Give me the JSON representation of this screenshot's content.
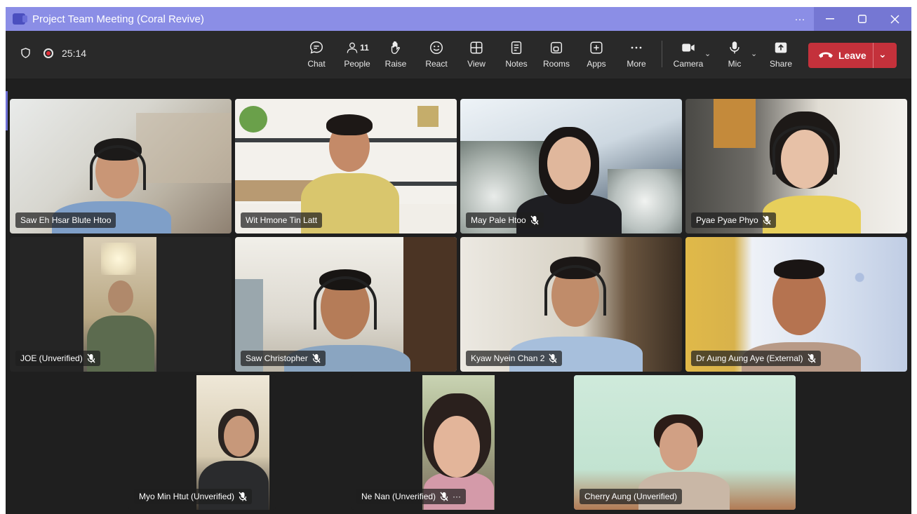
{
  "window": {
    "title": "Project Team Meeting (Coral Revive)",
    "more": "···"
  },
  "meeting": {
    "timer": "25:14"
  },
  "toolbar": {
    "chat": "Chat",
    "people": "People",
    "people_count": "11",
    "raise": "Raise",
    "react": "React",
    "view": "View",
    "notes": "Notes",
    "rooms": "Rooms",
    "apps": "Apps",
    "more": "More",
    "camera": "Camera",
    "mic": "Mic",
    "share": "Share",
    "leave": "Leave"
  },
  "participants": [
    {
      "name": "Saw Eh Hsar Blute Htoo",
      "muted": false
    },
    {
      "name": "Wit Hmone Tin Latt",
      "muted": false
    },
    {
      "name": "May Pale Htoo",
      "muted": true
    },
    {
      "name": "Pyae Pyae Phyo",
      "muted": true
    },
    {
      "name": "JOE (Unverified)",
      "muted": true
    },
    {
      "name": "Saw Christopher",
      "muted": true
    },
    {
      "name": "Kyaw Nyein Chan 2",
      "muted": true
    },
    {
      "name": "Dr Aung Aung Aye (External)",
      "muted": true
    },
    {
      "name": "Myo Min Htut (Unverified)",
      "muted": true
    },
    {
      "name": "Ne Nan (Unverified)",
      "muted": true,
      "options": "···"
    },
    {
      "name": "Cherry Aung (Unverified)",
      "muted": false
    }
  ],
  "colors": {
    "titlebar": "#8b8ee6",
    "leave": "#c4313b",
    "active_border": "#8e90ea",
    "stage": "#1f1f1f"
  }
}
